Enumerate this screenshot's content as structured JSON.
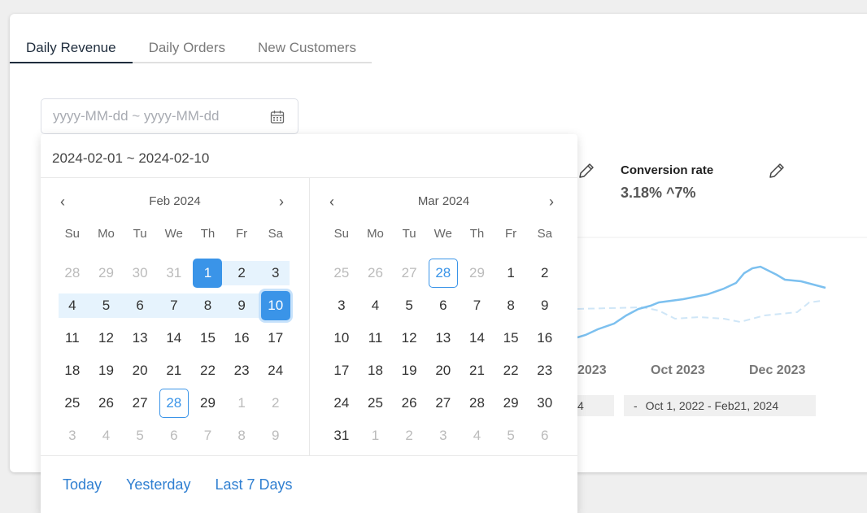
{
  "tabs": [
    {
      "label": "Daily Revenue",
      "active": true
    },
    {
      "label": "Daily Orders",
      "active": false
    },
    {
      "label": "New Customers",
      "active": false
    }
  ],
  "date_input": {
    "placeholder": "yyyy-MM-dd ~ yyyy-MM-dd",
    "icon": "calendar-icon"
  },
  "metric": {
    "title": "Conversion rate",
    "value": "3.18% ^7%"
  },
  "chart_axis": {
    "labels": [
      "2023",
      "Oct 2023",
      "Dec 2023"
    ]
  },
  "ranges": {
    "left": "4",
    "right_dash": "-",
    "right_text": "Oct 1, 2022 - Feb21, 2024"
  },
  "picker": {
    "selected_range": "2024-02-01 ~ 2024-02-10",
    "weekdays": [
      "Su",
      "Mo",
      "Tu",
      "We",
      "Th",
      "Fr",
      "Sa"
    ],
    "months": [
      {
        "title": "Feb 2024",
        "days": [
          {
            "d": "28",
            "s": "other"
          },
          {
            "d": "29",
            "s": "other"
          },
          {
            "d": "30",
            "s": "other"
          },
          {
            "d": "31",
            "s": "other"
          },
          {
            "d": "1",
            "s": "start"
          },
          {
            "d": "2",
            "s": "inrange"
          },
          {
            "d": "3",
            "s": "inrange"
          },
          {
            "d": "4",
            "s": "inrange"
          },
          {
            "d": "5",
            "s": "inrange"
          },
          {
            "d": "6",
            "s": "inrange"
          },
          {
            "d": "7",
            "s": "inrange"
          },
          {
            "d": "8",
            "s": "inrange"
          },
          {
            "d": "9",
            "s": "inrange"
          },
          {
            "d": "10",
            "s": "end"
          },
          {
            "d": "11",
            "s": ""
          },
          {
            "d": "12",
            "s": ""
          },
          {
            "d": "13",
            "s": ""
          },
          {
            "d": "14",
            "s": ""
          },
          {
            "d": "15",
            "s": ""
          },
          {
            "d": "16",
            "s": ""
          },
          {
            "d": "17",
            "s": ""
          },
          {
            "d": "18",
            "s": ""
          },
          {
            "d": "19",
            "s": ""
          },
          {
            "d": "20",
            "s": ""
          },
          {
            "d": "21",
            "s": ""
          },
          {
            "d": "22",
            "s": ""
          },
          {
            "d": "23",
            "s": ""
          },
          {
            "d": "24",
            "s": ""
          },
          {
            "d": "25",
            "s": ""
          },
          {
            "d": "26",
            "s": ""
          },
          {
            "d": "27",
            "s": ""
          },
          {
            "d": "28",
            "s": "today"
          },
          {
            "d": "29",
            "s": ""
          },
          {
            "d": "1",
            "s": "other"
          },
          {
            "d": "2",
            "s": "other"
          },
          {
            "d": "3",
            "s": "other"
          },
          {
            "d": "4",
            "s": "other"
          },
          {
            "d": "5",
            "s": "other"
          },
          {
            "d": "6",
            "s": "other"
          },
          {
            "d": "7",
            "s": "other"
          },
          {
            "d": "8",
            "s": "other"
          },
          {
            "d": "9",
            "s": "other"
          }
        ]
      },
      {
        "title": "Mar 2024",
        "days": [
          {
            "d": "25",
            "s": "other"
          },
          {
            "d": "26",
            "s": "other"
          },
          {
            "d": "27",
            "s": "other"
          },
          {
            "d": "28",
            "s": "other today"
          },
          {
            "d": "29",
            "s": "other"
          },
          {
            "d": "1",
            "s": ""
          },
          {
            "d": "2",
            "s": ""
          },
          {
            "d": "3",
            "s": ""
          },
          {
            "d": "4",
            "s": ""
          },
          {
            "d": "5",
            "s": ""
          },
          {
            "d": "6",
            "s": ""
          },
          {
            "d": "7",
            "s": ""
          },
          {
            "d": "8",
            "s": ""
          },
          {
            "d": "9",
            "s": ""
          },
          {
            "d": "10",
            "s": ""
          },
          {
            "d": "11",
            "s": ""
          },
          {
            "d": "12",
            "s": ""
          },
          {
            "d": "13",
            "s": ""
          },
          {
            "d": "14",
            "s": ""
          },
          {
            "d": "15",
            "s": ""
          },
          {
            "d": "16",
            "s": ""
          },
          {
            "d": "17",
            "s": ""
          },
          {
            "d": "18",
            "s": ""
          },
          {
            "d": "19",
            "s": ""
          },
          {
            "d": "20",
            "s": ""
          },
          {
            "d": "21",
            "s": ""
          },
          {
            "d": "22",
            "s": ""
          },
          {
            "d": "23",
            "s": ""
          },
          {
            "d": "24",
            "s": ""
          },
          {
            "d": "25",
            "s": ""
          },
          {
            "d": "26",
            "s": ""
          },
          {
            "d": "27",
            "s": ""
          },
          {
            "d": "28",
            "s": ""
          },
          {
            "d": "29",
            "s": ""
          },
          {
            "d": "30",
            "s": ""
          },
          {
            "d": "31",
            "s": ""
          },
          {
            "d": "1",
            "s": "other"
          },
          {
            "d": "2",
            "s": "other"
          },
          {
            "d": "3",
            "s": "other"
          },
          {
            "d": "4",
            "s": "other"
          },
          {
            "d": "5",
            "s": "other"
          },
          {
            "d": "6",
            "s": "other"
          }
        ]
      }
    ],
    "nav": {
      "prev": "‹",
      "next": "›"
    },
    "shortcuts": [
      "Today",
      "Yesterday",
      "Last 7 Days"
    ]
  },
  "colors": {
    "accent": "#3a94e8",
    "range": "#e6f3fd",
    "link": "#2f7fd1",
    "chart_line": "#7cc0ef"
  }
}
